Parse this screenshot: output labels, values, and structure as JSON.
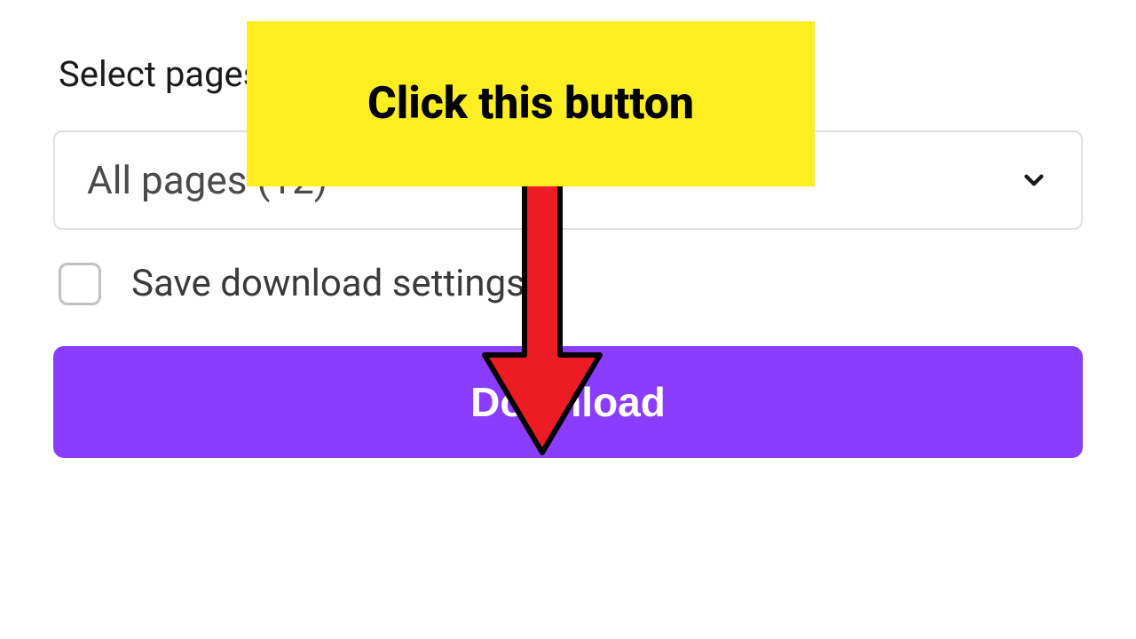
{
  "form": {
    "select_pages_label": "Select pages",
    "dropdown_value": "All pages (12)",
    "save_settings_label": "Save download settings",
    "save_settings_checked": false,
    "download_button_label": "Download"
  },
  "annotation": {
    "callout_text": "Click this button"
  },
  "colors": {
    "primary": "#8b3dff",
    "callout_bg": "#fcee21",
    "arrow_fill": "#ed1c24"
  }
}
